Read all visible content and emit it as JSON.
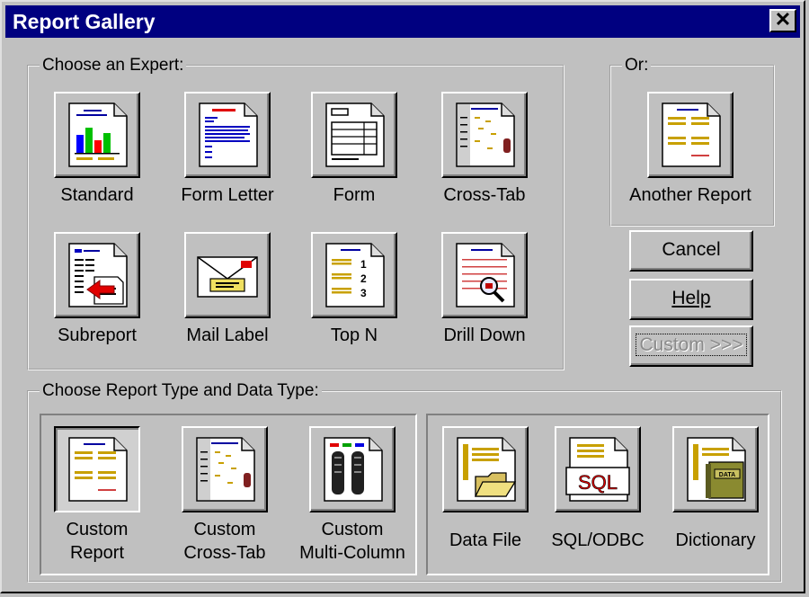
{
  "window": {
    "title": "Report Gallery",
    "close_glyph": "✕"
  },
  "experts": {
    "legend": "Choose an Expert:",
    "items": [
      {
        "label": "Standard",
        "icon": "standard-report-icon"
      },
      {
        "label": "Form Letter",
        "icon": "form-letter-icon"
      },
      {
        "label": "Form",
        "icon": "form-icon"
      },
      {
        "label": "Cross-Tab",
        "icon": "cross-tab-icon"
      },
      {
        "label": "Subreport",
        "icon": "subreport-icon"
      },
      {
        "label": "Mail Label",
        "icon": "mail-label-icon"
      },
      {
        "label": "Top N",
        "icon": "top-n-icon"
      },
      {
        "label": "Drill Down",
        "icon": "drill-down-icon"
      }
    ]
  },
  "or_group": {
    "legend": "Or:",
    "item": {
      "label": "Another Report",
      "icon": "another-report-icon"
    }
  },
  "buttons": {
    "cancel": "Cancel",
    "help": "Help",
    "custom": "Custom >>>"
  },
  "report_type": {
    "legend": "Choose Report Type and Data Type:",
    "types": [
      {
        "line1": "Custom",
        "line2": "Report",
        "icon": "custom-report-icon",
        "selected": true
      },
      {
        "line1": "Custom",
        "line2": "Cross-Tab",
        "icon": "custom-cross-tab-icon"
      },
      {
        "line1": "Custom",
        "line2": "Multi-Column",
        "icon": "custom-multi-column-icon"
      }
    ],
    "data_types": [
      {
        "label": "Data File",
        "icon": "data-file-icon"
      },
      {
        "label": "SQL/ODBC",
        "icon": "sql-odbc-icon",
        "icon_text": "SQL"
      },
      {
        "label": "Dictionary",
        "icon": "dictionary-icon",
        "icon_text": "DATA"
      }
    ]
  }
}
